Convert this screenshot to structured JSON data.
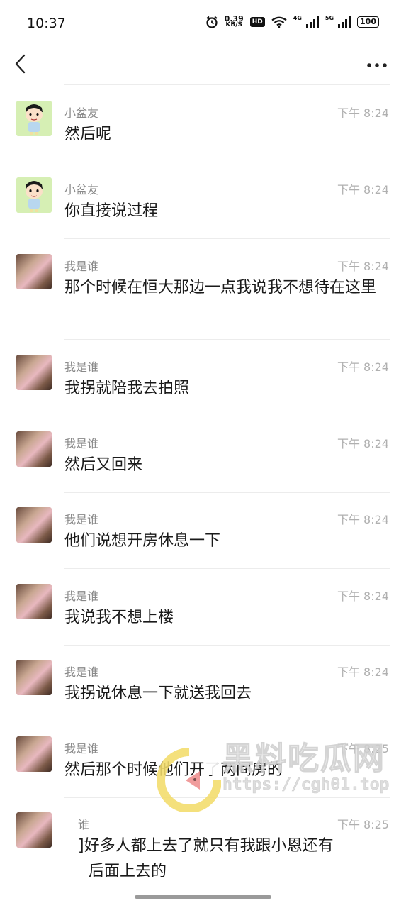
{
  "status_bar": {
    "time": "10:37",
    "net_speed_value": "0.39",
    "net_speed_unit": "KB/S",
    "hd": "HD",
    "sig1_label": "4G",
    "sig2_label": "5G",
    "battery": "100"
  },
  "top_bar": {
    "back_icon": "chevron-left-icon",
    "more_icon": "more-horizontal-icon"
  },
  "messages": [
    {
      "sender": "小盆友",
      "time": "下午 8:24",
      "text": "然后呢",
      "avatar": "cartoon-boy"
    },
    {
      "sender": "小盆友",
      "time": "下午 8:24",
      "text": "你直接说过程",
      "avatar": "cartoon-boy"
    },
    {
      "sender": "我是谁",
      "time": "下午 8:24",
      "text": "那个时候在恒大那边一点我说我不想待在这里",
      "avatar": "girl-photo"
    },
    {
      "sender": "我是谁",
      "time": "下午 8:24",
      "text": "我拐就陪我去拍照",
      "avatar": "girl-photo"
    },
    {
      "sender": "我是谁",
      "time": "下午 8:24",
      "text": "然后又回来",
      "avatar": "girl-photo"
    },
    {
      "sender": "我是谁",
      "time": "下午 8:24",
      "text": "他们说想开房休息一下",
      "avatar": "girl-photo"
    },
    {
      "sender": "我是谁",
      "time": "下午 8:24",
      "text": "我说我不想上楼",
      "avatar": "girl-photo"
    },
    {
      "sender": "我是谁",
      "time": "下午 8:24",
      "text": "我拐说休息一下就送我回去",
      "avatar": "girl-photo"
    },
    {
      "sender": "我是谁",
      "time": "下午 8:25",
      "text": "然后那个时候他们开了两间房的",
      "avatar": "girl-photo"
    },
    {
      "sender": "谁",
      "time": "下午 8:25",
      "text": "]好多人都上去了就只有我跟小恩还有",
      "text2": "后面上去的",
      "avatar": "girl-photo"
    }
  ],
  "watermark": {
    "title": "黑料吃瓜网",
    "url": "https://cgh01.top"
  }
}
